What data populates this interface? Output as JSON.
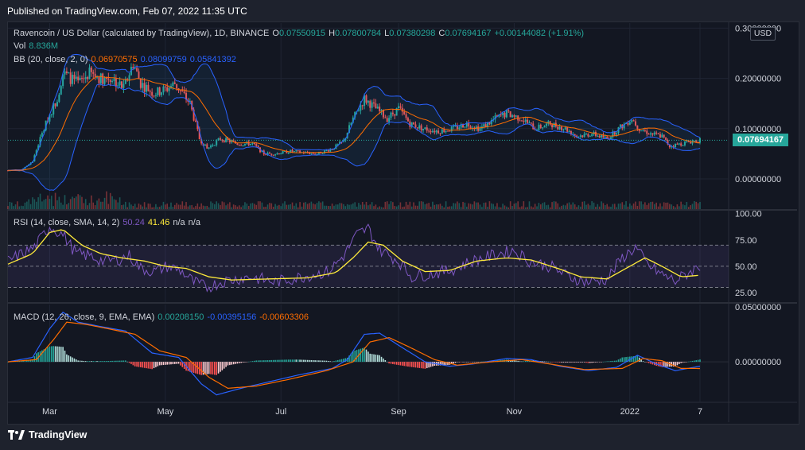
{
  "header": {
    "published": "Published on TradingView.com, Feb 07, 2022 11:35 UTC"
  },
  "footer": {
    "brand": "TradingView"
  },
  "colors": {
    "up": "#26a69a",
    "down": "#ef5350",
    "bb": "#2962ff",
    "bb_basis": "#ff6d00",
    "rsi": "#7e57c2",
    "rsi_ma": "#ffeb3b",
    "macd": "#2962ff",
    "signal": "#ff6d00"
  },
  "legend": {
    "main": {
      "title": "Ravencoin / US Dollar (calculated by TradingView), 1D, BINANCE",
      "o_label": "O",
      "o": "0.07550915",
      "h_label": "H",
      "h": "0.07800784",
      "l_label": "L",
      "l": "0.07380298",
      "c_label": "C",
      "c": "0.07694167",
      "change": "+0.00144082 (+1.91%)"
    },
    "vol": {
      "label": "Vol",
      "value": "8.836M"
    },
    "bb": {
      "label": "BB (20, close, 2, 0)",
      "basis": "0.06970575",
      "upper": "0.08099759",
      "lower": "0.05841392"
    },
    "rsi": {
      "label": "RSI (14, close, SMA, 14, 2)",
      "rsi": "50.24",
      "ma": "41.46",
      "na1": "n/a",
      "na2": "n/a"
    },
    "macd": {
      "label": "MACD (12, 26, close, 9, EMA, EMA)",
      "hist": "0.00208150",
      "macd": "-0.00395156",
      "signal": "-0.00603306"
    }
  },
  "price_axis": {
    "currency": "USD",
    "last_price": "0.07694167",
    "ticks": [
      "0.30000000",
      "0.20000000",
      "0.10000000",
      "0.00000000"
    ]
  },
  "rsi_axis": {
    "ticks": [
      "100.00",
      "75.00",
      "50.00",
      "25.00"
    ]
  },
  "macd_axis": {
    "ticks": [
      "0.05000000",
      "0.00000000"
    ]
  },
  "time_axis": {
    "labels": [
      "Mar",
      "May",
      "Jul",
      "Sep",
      "Nov",
      "2022",
      "7"
    ]
  },
  "chart_data": {
    "type": "candlestick",
    "period": "1D",
    "x_range": [
      "2021-02-07",
      "2022-02-07"
    ],
    "price_ylim": [
      -0.06,
      0.31
    ],
    "close_path": [
      [
        "2021-02-07",
        0.017
      ],
      [
        "2021-02-14",
        0.018
      ],
      [
        "2021-02-20",
        0.035
      ],
      [
        "2021-02-24",
        0.08
      ],
      [
        "2021-02-28",
        0.12
      ],
      [
        "2021-03-05",
        0.16
      ],
      [
        "2021-03-08",
        0.21
      ],
      [
        "2021-03-12",
        0.2
      ],
      [
        "2021-03-16",
        0.19
      ],
      [
        "2021-03-22",
        0.21
      ],
      [
        "2021-03-28",
        0.2
      ],
      [
        "2021-04-03",
        0.2
      ],
      [
        "2021-04-09",
        0.18
      ],
      [
        "2021-04-14",
        0.23
      ],
      [
        "2021-04-18",
        0.19
      ],
      [
        "2021-04-25",
        0.17
      ],
      [
        "2021-05-02",
        0.18
      ],
      [
        "2021-05-06",
        0.19
      ],
      [
        "2021-05-10",
        0.17
      ],
      [
        "2021-05-14",
        0.15
      ],
      [
        "2021-05-19",
        0.08
      ],
      [
        "2021-05-23",
        0.06
      ],
      [
        "2021-05-30",
        0.08
      ],
      [
        "2021-06-08",
        0.07
      ],
      [
        "2021-06-16",
        0.07
      ],
      [
        "2021-06-22",
        0.05
      ],
      [
        "2021-06-28",
        0.05
      ],
      [
        "2021-07-06",
        0.055
      ],
      [
        "2021-07-14",
        0.052
      ],
      [
        "2021-07-20",
        0.05
      ],
      [
        "2021-07-28",
        0.06
      ],
      [
        "2021-08-03",
        0.075
      ],
      [
        "2021-08-08",
        0.12
      ],
      [
        "2021-08-14",
        0.16
      ],
      [
        "2021-08-20",
        0.14
      ],
      [
        "2021-08-26",
        0.12
      ],
      [
        "2021-09-01",
        0.14
      ],
      [
        "2021-09-07",
        0.11
      ],
      [
        "2021-09-14",
        0.1
      ],
      [
        "2021-09-22",
        0.095
      ],
      [
        "2021-09-30",
        0.1
      ],
      [
        "2021-10-07",
        0.11
      ],
      [
        "2021-10-14",
        0.1
      ],
      [
        "2021-10-22",
        0.12
      ],
      [
        "2021-10-28",
        0.13
      ],
      [
        "2021-11-05",
        0.12
      ],
      [
        "2021-11-12",
        0.1
      ],
      [
        "2021-11-20",
        0.11
      ],
      [
        "2021-11-28",
        0.1
      ],
      [
        "2021-12-04",
        0.085
      ],
      [
        "2021-12-12",
        0.09
      ],
      [
        "2021-12-20",
        0.08
      ],
      [
        "2021-12-26",
        0.1
      ],
      [
        "2022-01-02",
        0.12
      ],
      [
        "2022-01-06",
        0.1
      ],
      [
        "2022-01-12",
        0.09
      ],
      [
        "2022-01-18",
        0.085
      ],
      [
        "2022-01-22",
        0.065
      ],
      [
        "2022-01-28",
        0.07
      ],
      [
        "2022-02-03",
        0.075
      ],
      [
        "2022-02-07",
        0.077
      ]
    ],
    "rsi_ylim": [
      16,
      102
    ],
    "rsi_bands": [
      30,
      50,
      70
    ],
    "rsi_path": [
      [
        "2021-02-07",
        55
      ],
      [
        "2021-02-21",
        68
      ],
      [
        "2021-03-01",
        88
      ],
      [
        "2021-03-08",
        80
      ],
      [
        "2021-03-15",
        62
      ],
      [
        "2021-03-22",
        60
      ],
      [
        "2021-03-29",
        55
      ],
      [
        "2021-04-05",
        56
      ],
      [
        "2021-04-12",
        60
      ],
      [
        "2021-04-18",
        48
      ],
      [
        "2021-04-25",
        45
      ],
      [
        "2021-05-02",
        50
      ],
      [
        "2021-05-09",
        46
      ],
      [
        "2021-05-16",
        35
      ],
      [
        "2021-05-23",
        30
      ],
      [
        "2021-06-01",
        36
      ],
      [
        "2021-06-15",
        40
      ],
      [
        "2021-06-28",
        35
      ],
      [
        "2021-07-12",
        40
      ],
      [
        "2021-07-26",
        45
      ],
      [
        "2021-08-03",
        60
      ],
      [
        "2021-08-10",
        80
      ],
      [
        "2021-08-16",
        86
      ],
      [
        "2021-08-22",
        66
      ],
      [
        "2021-09-01",
        55
      ],
      [
        "2021-09-08",
        40
      ],
      [
        "2021-09-15",
        42
      ],
      [
        "2021-09-28",
        46
      ],
      [
        "2021-10-10",
        55
      ],
      [
        "2021-10-24",
        62
      ],
      [
        "2021-11-01",
        65
      ],
      [
        "2021-11-10",
        54
      ],
      [
        "2021-11-20",
        50
      ],
      [
        "2021-11-30",
        40
      ],
      [
        "2021-12-10",
        35
      ],
      [
        "2021-12-20",
        38
      ],
      [
        "2021-12-28",
        58
      ],
      [
        "2022-01-04",
        68
      ],
      [
        "2022-01-10",
        52
      ],
      [
        "2022-01-18",
        42
      ],
      [
        "2022-01-25",
        36
      ],
      [
        "2022-02-01",
        44
      ],
      [
        "2022-02-07",
        50.24
      ]
    ],
    "rsi_ma_path": [
      [
        "2021-02-07",
        52
      ],
      [
        "2021-02-20",
        62
      ],
      [
        "2021-03-01",
        82
      ],
      [
        "2021-03-08",
        85
      ],
      [
        "2021-03-18",
        70
      ],
      [
        "2021-03-28",
        62
      ],
      [
        "2021-04-08",
        58
      ],
      [
        "2021-04-20",
        55
      ],
      [
        "2021-05-01",
        50
      ],
      [
        "2021-05-12",
        48
      ],
      [
        "2021-05-24",
        40
      ],
      [
        "2021-06-05",
        37
      ],
      [
        "2021-06-25",
        38
      ],
      [
        "2021-07-15",
        39
      ],
      [
        "2021-07-30",
        44
      ],
      [
        "2021-08-08",
        58
      ],
      [
        "2021-08-16",
        73
      ],
      [
        "2021-08-24",
        70
      ],
      [
        "2021-09-03",
        55
      ],
      [
        "2021-09-15",
        45
      ],
      [
        "2021-09-28",
        46
      ],
      [
        "2021-10-12",
        55
      ],
      [
        "2021-10-28",
        58
      ],
      [
        "2021-11-10",
        56
      ],
      [
        "2021-11-24",
        48
      ],
      [
        "2021-12-06",
        40
      ],
      [
        "2021-12-20",
        38
      ],
      [
        "2022-01-01",
        50
      ],
      [
        "2022-01-09",
        58
      ],
      [
        "2022-01-18",
        50
      ],
      [
        "2022-01-28",
        40
      ],
      [
        "2022-02-07",
        41.46
      ]
    ],
    "macd_ylim": [
      -0.036,
      0.052
    ],
    "macd_path": [
      [
        "2021-02-07",
        0.0
      ],
      [
        "2021-02-20",
        0.004
      ],
      [
        "2021-03-01",
        0.03
      ],
      [
        "2021-03-08",
        0.045
      ],
      [
        "2021-03-16",
        0.036
      ],
      [
        "2021-03-28",
        0.032
      ],
      [
        "2021-04-10",
        0.028
      ],
      [
        "2021-04-24",
        0.008
      ],
      [
        "2021-05-08",
        0.004
      ],
      [
        "2021-05-20",
        -0.02
      ],
      [
        "2021-05-28",
        -0.03
      ],
      [
        "2021-06-10",
        -0.024
      ],
      [
        "2021-06-25",
        -0.018
      ],
      [
        "2021-07-10",
        -0.012
      ],
      [
        "2021-07-28",
        -0.006
      ],
      [
        "2021-08-05",
        0.002
      ],
      [
        "2021-08-14",
        0.025
      ],
      [
        "2021-08-22",
        0.026
      ],
      [
        "2021-09-02",
        0.014
      ],
      [
        "2021-09-15",
        0.0
      ],
      [
        "2021-09-28",
        -0.004
      ],
      [
        "2021-10-10",
        -0.002
      ],
      [
        "2021-10-28",
        0.003
      ],
      [
        "2021-11-10",
        0.002
      ],
      [
        "2021-11-25",
        -0.004
      ],
      [
        "2021-12-10",
        -0.008
      ],
      [
        "2021-12-25",
        -0.005
      ],
      [
        "2022-01-05",
        0.006
      ],
      [
        "2022-01-15",
        -0.002
      ],
      [
        "2022-01-25",
        -0.008
      ],
      [
        "2022-02-07",
        -0.00395156
      ]
    ],
    "signal_path": [
      [
        "2021-02-07",
        0.0
      ],
      [
        "2021-02-22",
        0.002
      ],
      [
        "2021-03-03",
        0.02
      ],
      [
        "2021-03-10",
        0.036
      ],
      [
        "2021-03-20",
        0.034
      ],
      [
        "2021-04-01",
        0.03
      ],
      [
        "2021-04-15",
        0.025
      ],
      [
        "2021-04-28",
        0.01
      ],
      [
        "2021-05-12",
        0.004
      ],
      [
        "2021-05-24",
        -0.014
      ],
      [
        "2021-06-03",
        -0.024
      ],
      [
        "2021-06-18",
        -0.022
      ],
      [
        "2021-07-05",
        -0.016
      ],
      [
        "2021-07-25",
        -0.008
      ],
      [
        "2021-08-08",
        0.0
      ],
      [
        "2021-08-17",
        0.018
      ],
      [
        "2021-08-27",
        0.022
      ],
      [
        "2021-09-06",
        0.014
      ],
      [
        "2021-09-20",
        0.002
      ],
      [
        "2021-10-02",
        -0.003
      ],
      [
        "2021-10-20",
        0.0
      ],
      [
        "2021-11-05",
        0.002
      ],
      [
        "2021-11-20",
        -0.002
      ],
      [
        "2021-12-08",
        -0.007
      ],
      [
        "2021-12-28",
        -0.006
      ],
      [
        "2022-01-08",
        0.003
      ],
      [
        "2022-01-18",
        0.001
      ],
      [
        "2022-01-28",
        -0.006
      ],
      [
        "2022-02-07",
        -0.00603306
      ]
    ]
  }
}
